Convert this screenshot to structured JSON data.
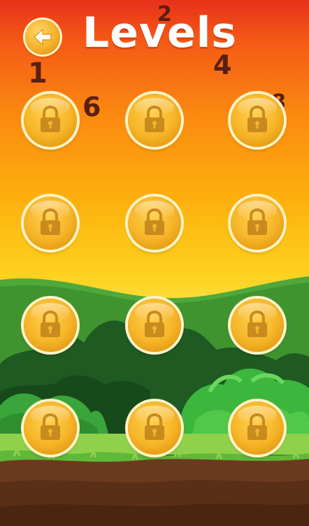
{
  "screen": {
    "title": "Levels",
    "back_button": {
      "icon": "back-arrow-icon"
    }
  },
  "level_numbers_visible": [
    "1",
    "2",
    "4",
    "6",
    "8"
  ],
  "levels": [
    {
      "id": 1,
      "state": "locked",
      "icon": "lock-icon"
    },
    {
      "id": 2,
      "state": "locked",
      "icon": "lock-icon"
    },
    {
      "id": 3,
      "state": "locked",
      "icon": "lock-icon"
    },
    {
      "id": 4,
      "state": "locked",
      "icon": "lock-icon"
    },
    {
      "id": 5,
      "state": "locked",
      "icon": "lock-icon"
    },
    {
      "id": 6,
      "state": "locked",
      "icon": "lock-icon"
    },
    {
      "id": 7,
      "state": "locked",
      "icon": "lock-icon"
    },
    {
      "id": 8,
      "state": "locked",
      "icon": "lock-icon"
    },
    {
      "id": 9,
      "state": "locked",
      "icon": "lock-icon"
    },
    {
      "id": 10,
      "state": "locked",
      "icon": "lock-icon"
    },
    {
      "id": 11,
      "state": "locked",
      "icon": "lock-icon"
    },
    {
      "id": 12,
      "state": "locked",
      "icon": "lock-icon"
    }
  ],
  "colors": {
    "sky_top": "#e8311a",
    "sky_bottom": "#fde24a",
    "coin": "#f7b62a",
    "number_color": "#5a1f12",
    "grass": "#5fb83a",
    "dirt": "#6b3a1e"
  }
}
